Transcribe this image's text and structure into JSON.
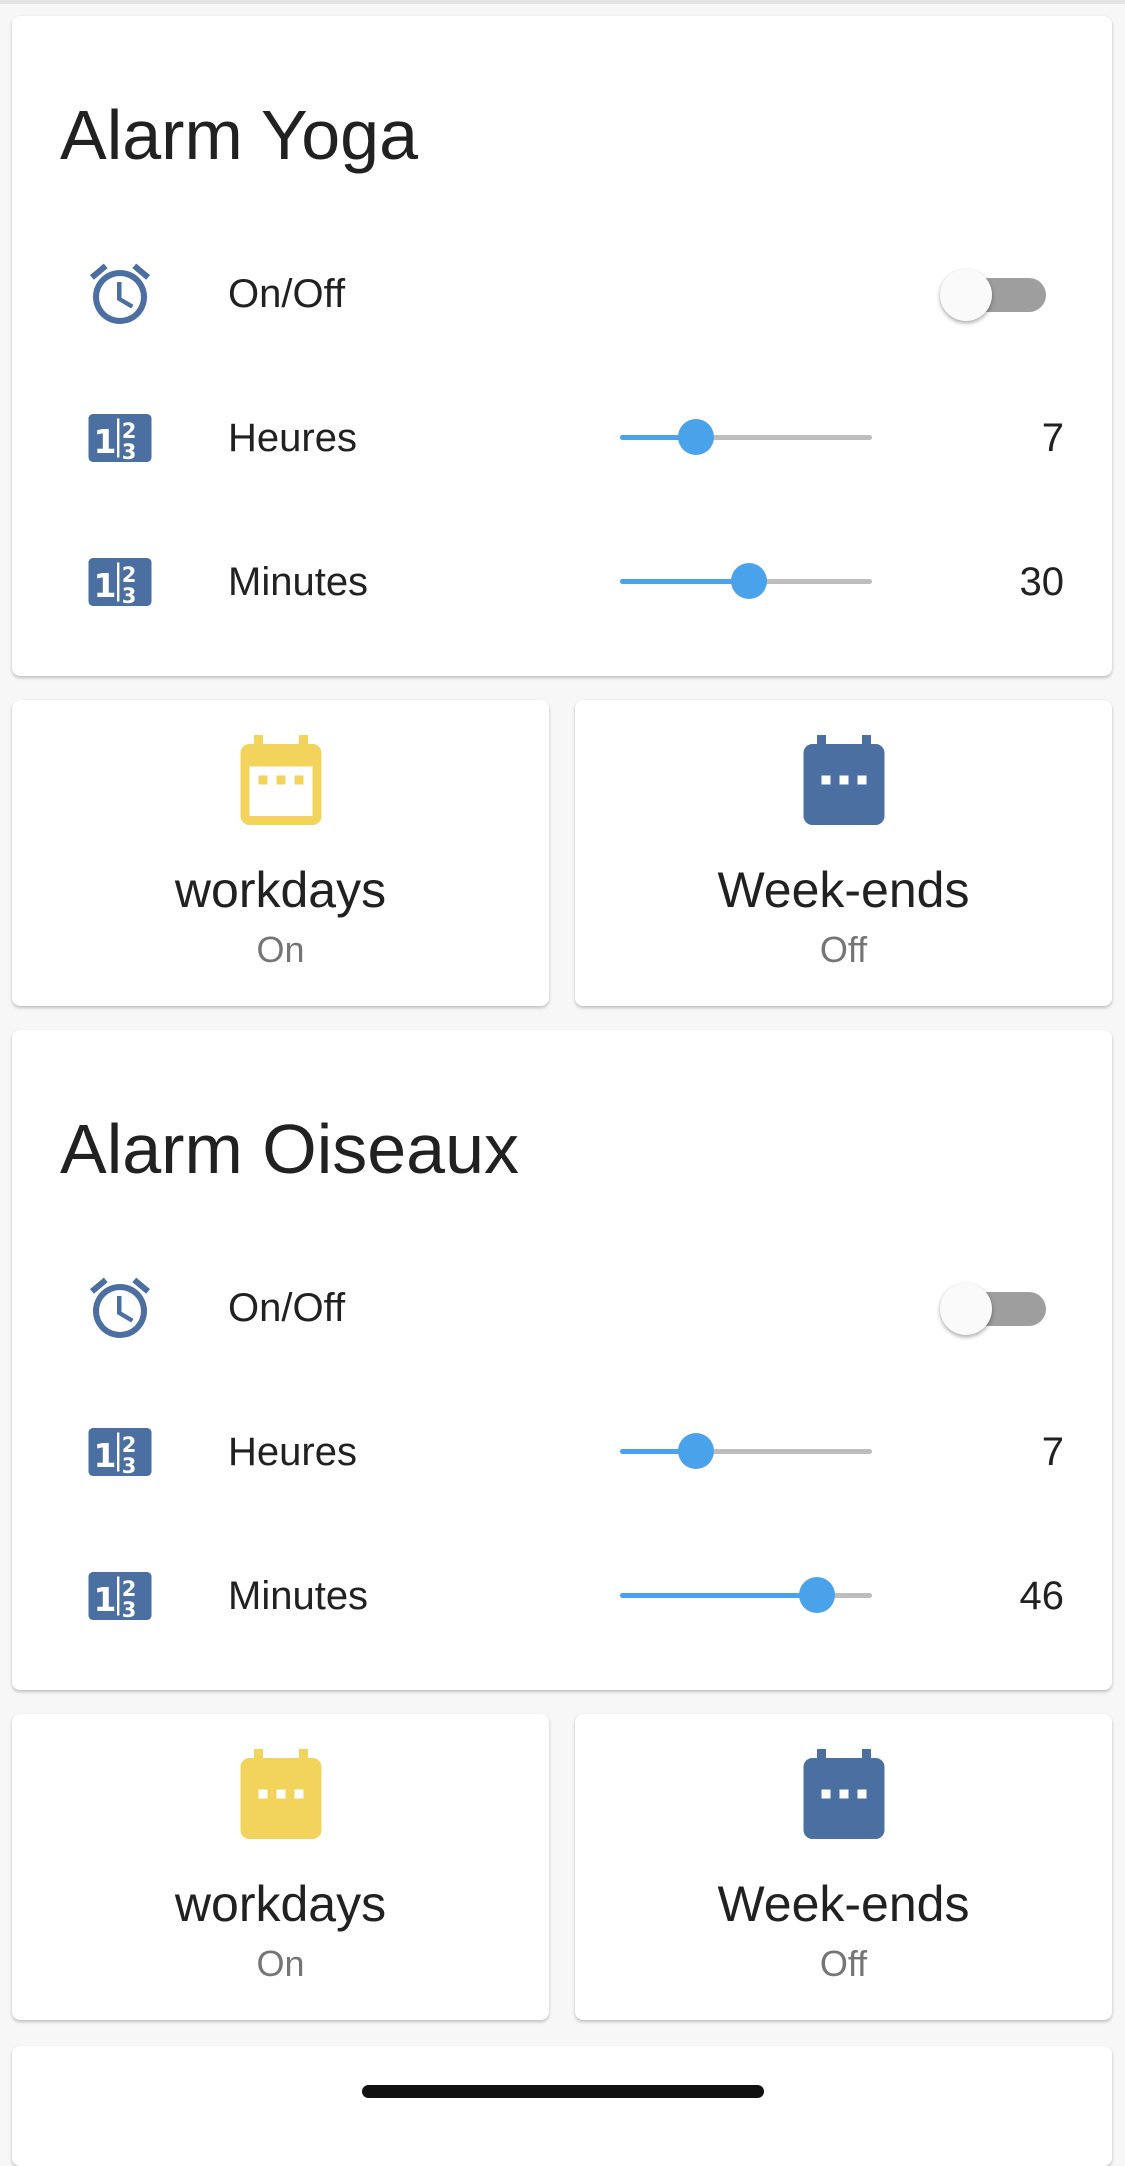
{
  "colors": {
    "accent": "#4aa3ea",
    "icon_blue": "#4a6fa0",
    "icon_yellow": "#f2d45c",
    "toggle_off": "#9e9e9e",
    "secondary_text": "#757575"
  },
  "alarms": [
    {
      "title": "Alarm Yoga",
      "switch": {
        "label": "On/Off",
        "icon": "alarm-clock-icon",
        "on": false
      },
      "hours": {
        "label": "Heures",
        "icon": "numeric-icon",
        "value": "7",
        "fraction": 0.3
      },
      "minutes": {
        "label": "Minutes",
        "icon": "numeric-icon",
        "value": "30",
        "fraction": 0.51
      },
      "workdays": {
        "name": "workdays",
        "state": "On",
        "icon": "calendar-icon",
        "color": "#f2d45c"
      },
      "weekends": {
        "name": "Week-ends",
        "state": "Off",
        "icon": "calendar-icon",
        "color": "#4a6fa0"
      }
    },
    {
      "title": "Alarm Oiseaux",
      "switch": {
        "label": "On/Off",
        "icon": "alarm-clock-icon",
        "on": false
      },
      "hours": {
        "label": "Heures",
        "icon": "numeric-icon",
        "value": "7",
        "fraction": 0.3
      },
      "minutes": {
        "label": "Minutes",
        "icon": "numeric-icon",
        "value": "46",
        "fraction": 0.78
      },
      "workdays": {
        "name": "workdays",
        "state": "On",
        "icon": "calendar-icon",
        "color": "#f2d45c"
      },
      "weekends": {
        "name": "Week-ends",
        "state": "Off",
        "icon": "calendar-icon",
        "color": "#4a6fa0"
      }
    }
  ]
}
